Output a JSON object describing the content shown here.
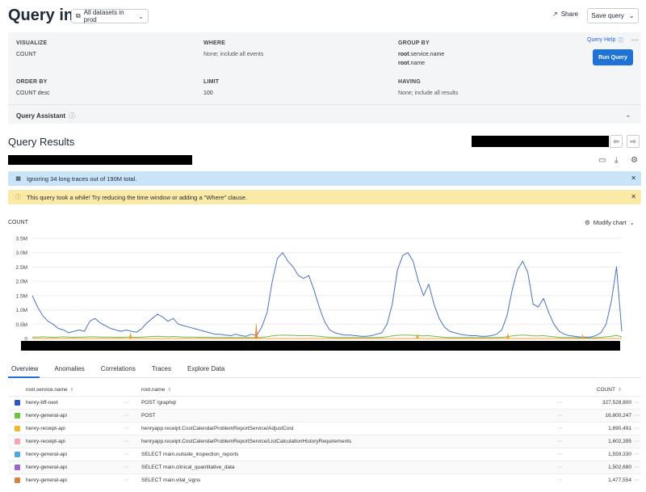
{
  "header": {
    "title": "Query in",
    "dataset_label": "All datasets in prod",
    "share_label": "Share",
    "save_label": "Save query"
  },
  "query": {
    "visualize": {
      "label": "VISUALIZE",
      "value": "COUNT"
    },
    "where": {
      "label": "WHERE",
      "value": "None; include all events"
    },
    "group_by": {
      "label": "GROUP BY",
      "values": [
        {
          "prefix": "root",
          "rest": ".service.name"
        },
        {
          "prefix": "root",
          "rest": ".name"
        }
      ]
    },
    "order_by": {
      "label": "ORDER BY",
      "value": "COUNT desc"
    },
    "limit": {
      "label": "LIMIT",
      "value": "100"
    },
    "having": {
      "label": "HAVING",
      "value": "None; include all results"
    },
    "help_label": "Query Help",
    "run_label": "Run Query",
    "assistant_label": "Query Assistant"
  },
  "results": {
    "title": "Query Results",
    "info_banner": "Ignoring 34 long traces out of 190M total.",
    "warn_banner": "This query took a while! Try reducing the time window or adding a \"Where\" clause.",
    "chart_label": "COUNT",
    "modify_label": "Modify chart"
  },
  "chart_data": {
    "type": "line",
    "ylabel": "COUNT",
    "ylim": [
      0,
      3500000
    ],
    "y_ticks": [
      "3.5M",
      "3.0M",
      "2.5M",
      "2.0M",
      "1.5M",
      "1.0M",
      "0.5M",
      "0"
    ],
    "series": [
      {
        "color": "#4a72c4",
        "values": [
          1500000,
          1100000,
          800000,
          600000,
          500000,
          350000,
          300000,
          200000,
          250000,
          300000,
          250000,
          600000,
          700000,
          550000,
          450000,
          350000,
          300000,
          250000,
          300000,
          250000,
          220000,
          350000,
          550000,
          700000,
          850000,
          750000,
          600000,
          700000,
          500000,
          450000,
          400000,
          350000,
          300000,
          250000,
          200000,
          150000,
          150000,
          120000,
          100000,
          150000,
          100000,
          80000,
          150000,
          100000,
          400000,
          900000,
          2000000,
          2800000,
          3000000,
          2700000,
          2500000,
          2200000,
          2100000,
          2200000,
          1700000,
          1100000,
          600000,
          300000,
          200000,
          150000,
          120000,
          120000,
          100000,
          80000,
          80000,
          100000,
          150000,
          200000,
          500000,
          1200000,
          2400000,
          2900000,
          3000000,
          2700000,
          2000000,
          1500000,
          1900000,
          1200000,
          700000,
          400000,
          250000,
          200000,
          150000,
          120000,
          100000,
          100000,
          80000,
          80000,
          100000,
          150000,
          300000,
          800000,
          1700000,
          2400000,
          2700000,
          2300000,
          1200000,
          1100000,
          1400000,
          900000,
          500000,
          250000,
          150000,
          100000,
          80000,
          50000,
          50000,
          50000,
          100000,
          200000,
          500000,
          1300000,
          2500000,
          250000
        ]
      },
      {
        "color": "#79b84a",
        "values": [
          50000,
          50000,
          60000,
          50000,
          40000,
          50000,
          60000,
          50000,
          40000,
          50000,
          50000,
          60000,
          60000,
          50000,
          50000,
          50000,
          40000,
          40000,
          50000,
          50000,
          40000,
          50000,
          60000,
          70000,
          80000,
          70000,
          60000,
          70000,
          60000,
          50000,
          50000,
          50000,
          40000,
          40000,
          40000,
          30000,
          30000,
          30000,
          30000,
          30000,
          30000,
          30000,
          30000,
          30000,
          40000,
          60000,
          90000,
          110000,
          120000,
          110000,
          110000,
          100000,
          100000,
          100000,
          90000,
          80000,
          60000,
          40000,
          30000,
          30000,
          30000,
          30000,
          30000,
          30000,
          30000,
          30000,
          30000,
          40000,
          60000,
          90000,
          110000,
          120000,
          120000,
          110000,
          100000,
          90000,
          100000,
          80000,
          60000,
          40000,
          30000,
          30000,
          30000,
          30000,
          30000,
          30000,
          30000,
          30000,
          30000,
          30000,
          40000,
          60000,
          90000,
          110000,
          120000,
          110000,
          90000,
          90000,
          100000,
          80000,
          60000,
          40000,
          30000,
          30000,
          30000,
          20000,
          20000,
          20000,
          30000,
          40000,
          60000,
          80000,
          110000,
          60000
        ]
      },
      {
        "color": "#e9a23b",
        "values": [
          0,
          0,
          0,
          0,
          0,
          0,
          0,
          0,
          0,
          0,
          0,
          0,
          0,
          0,
          0,
          0,
          0,
          0,
          0,
          0,
          0,
          0,
          0,
          0,
          0,
          0,
          0,
          0,
          0,
          0,
          0,
          0,
          0,
          0,
          0,
          0,
          0,
          0,
          0,
          0,
          0,
          0,
          0,
          0,
          0,
          0,
          0,
          0,
          0,
          0,
          0,
          0,
          0,
          0,
          0,
          0,
          0,
          0,
          0,
          0,
          0,
          0,
          0,
          0,
          0,
          0,
          0,
          0,
          0,
          0,
          0,
          0,
          0,
          0,
          0,
          0,
          0,
          0,
          0,
          0,
          0,
          0,
          0,
          0,
          0,
          0,
          0,
          0,
          0,
          0,
          0,
          0,
          0,
          0,
          0,
          0,
          0,
          0,
          0,
          0,
          0,
          0,
          0,
          0,
          0,
          0,
          0,
          0,
          0,
          0,
          0,
          0,
          0,
          0
        ]
      }
    ],
    "spikes": [
      {
        "index": 25,
        "value": 220000,
        "color": "#e9a23b"
      },
      {
        "index": 57,
        "value": 550000,
        "color": "#f0883e"
      },
      {
        "index": 98,
        "value": 180000,
        "color": "#e9a23b"
      },
      {
        "index": 121,
        "value": 200000,
        "color": "#e9a23b"
      },
      {
        "index": 140,
        "value": 150000,
        "color": "#e9a23b"
      }
    ]
  },
  "tabs": [
    "Overview",
    "Anomalies",
    "Correlations",
    "Traces",
    "Explore Data"
  ],
  "table": {
    "headers": {
      "service": "root.service.name",
      "name": "root.name",
      "count": "COUNT"
    },
    "rows": [
      {
        "color": "#2d56c7",
        "service": "henry-bff-next",
        "name": "POST /graphql",
        "count": "327,528,800"
      },
      {
        "color": "#6cc43a",
        "service": "henry-general-api",
        "name": "POST",
        "count": "16,800,247"
      },
      {
        "color": "#f2b726",
        "service": "henry-receipt-api",
        "name": "henryapp.receipt.CostCalendarProblemReportService/AdjustCost",
        "count": "1,690,491"
      },
      {
        "color": "#f4a3b2",
        "service": "henry-receipt-api",
        "name": "henryapp.receipt.CostCalendarProblemReportService/ListCalculationHistoryRequirements",
        "count": "1,602,395"
      },
      {
        "color": "#4fa8e0",
        "service": "henry-general-api",
        "name": "SELECT main.outside_inspection_reports",
        "count": "1,559,330"
      },
      {
        "color": "#9a66c9",
        "service": "henry-general-api",
        "name": "SELECT main.clinical_quantitative_data",
        "count": "1,502,680"
      },
      {
        "color": "#d8823e",
        "service": "henry-general-api",
        "name": "SELECT main.vital_signs",
        "count": "1,477,554"
      }
    ]
  }
}
